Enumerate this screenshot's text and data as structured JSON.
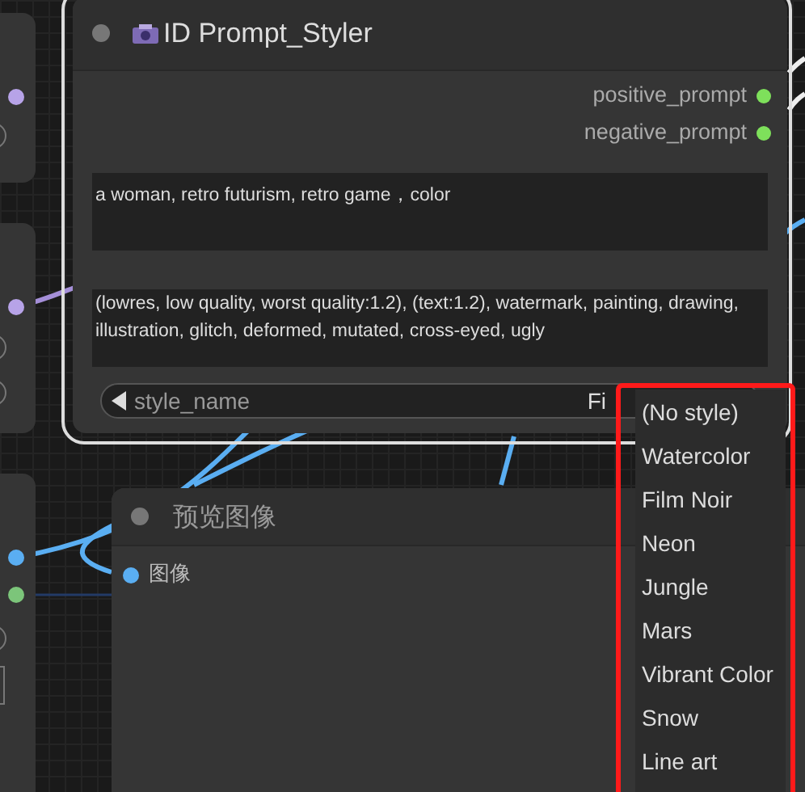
{
  "styler_node": {
    "title": "ID Prompt_Styler",
    "outputs": [
      {
        "label": "positive_prompt",
        "color": "#7ee05b"
      },
      {
        "label": "negative_prompt",
        "color": "#7ee05b"
      }
    ],
    "positive_text": "a woman, retro futurism, retro game，color",
    "negative_text": "(lowres, low quality, worst quality:1.2), (text:1.2), watermark, painting, drawing, illustration, glitch, deformed, mutated, cross-eyed, ugly",
    "combo": {
      "label": "style_name",
      "value": "Fi"
    },
    "selected": true
  },
  "preview_node": {
    "title": "预览图像",
    "inputs": [
      {
        "label": "图像",
        "color": "#5aaef2"
      }
    ]
  },
  "dropdown": {
    "highlighted": true,
    "items": [
      {
        "label": "(No style)"
      },
      {
        "label": "Watercolor"
      },
      {
        "label": "Film Noir"
      },
      {
        "label": "Neon"
      },
      {
        "label": "Jungle"
      },
      {
        "label": "Mars"
      },
      {
        "label": "Vibrant Color"
      },
      {
        "label": "Snow"
      },
      {
        "label": "Line art"
      }
    ]
  }
}
